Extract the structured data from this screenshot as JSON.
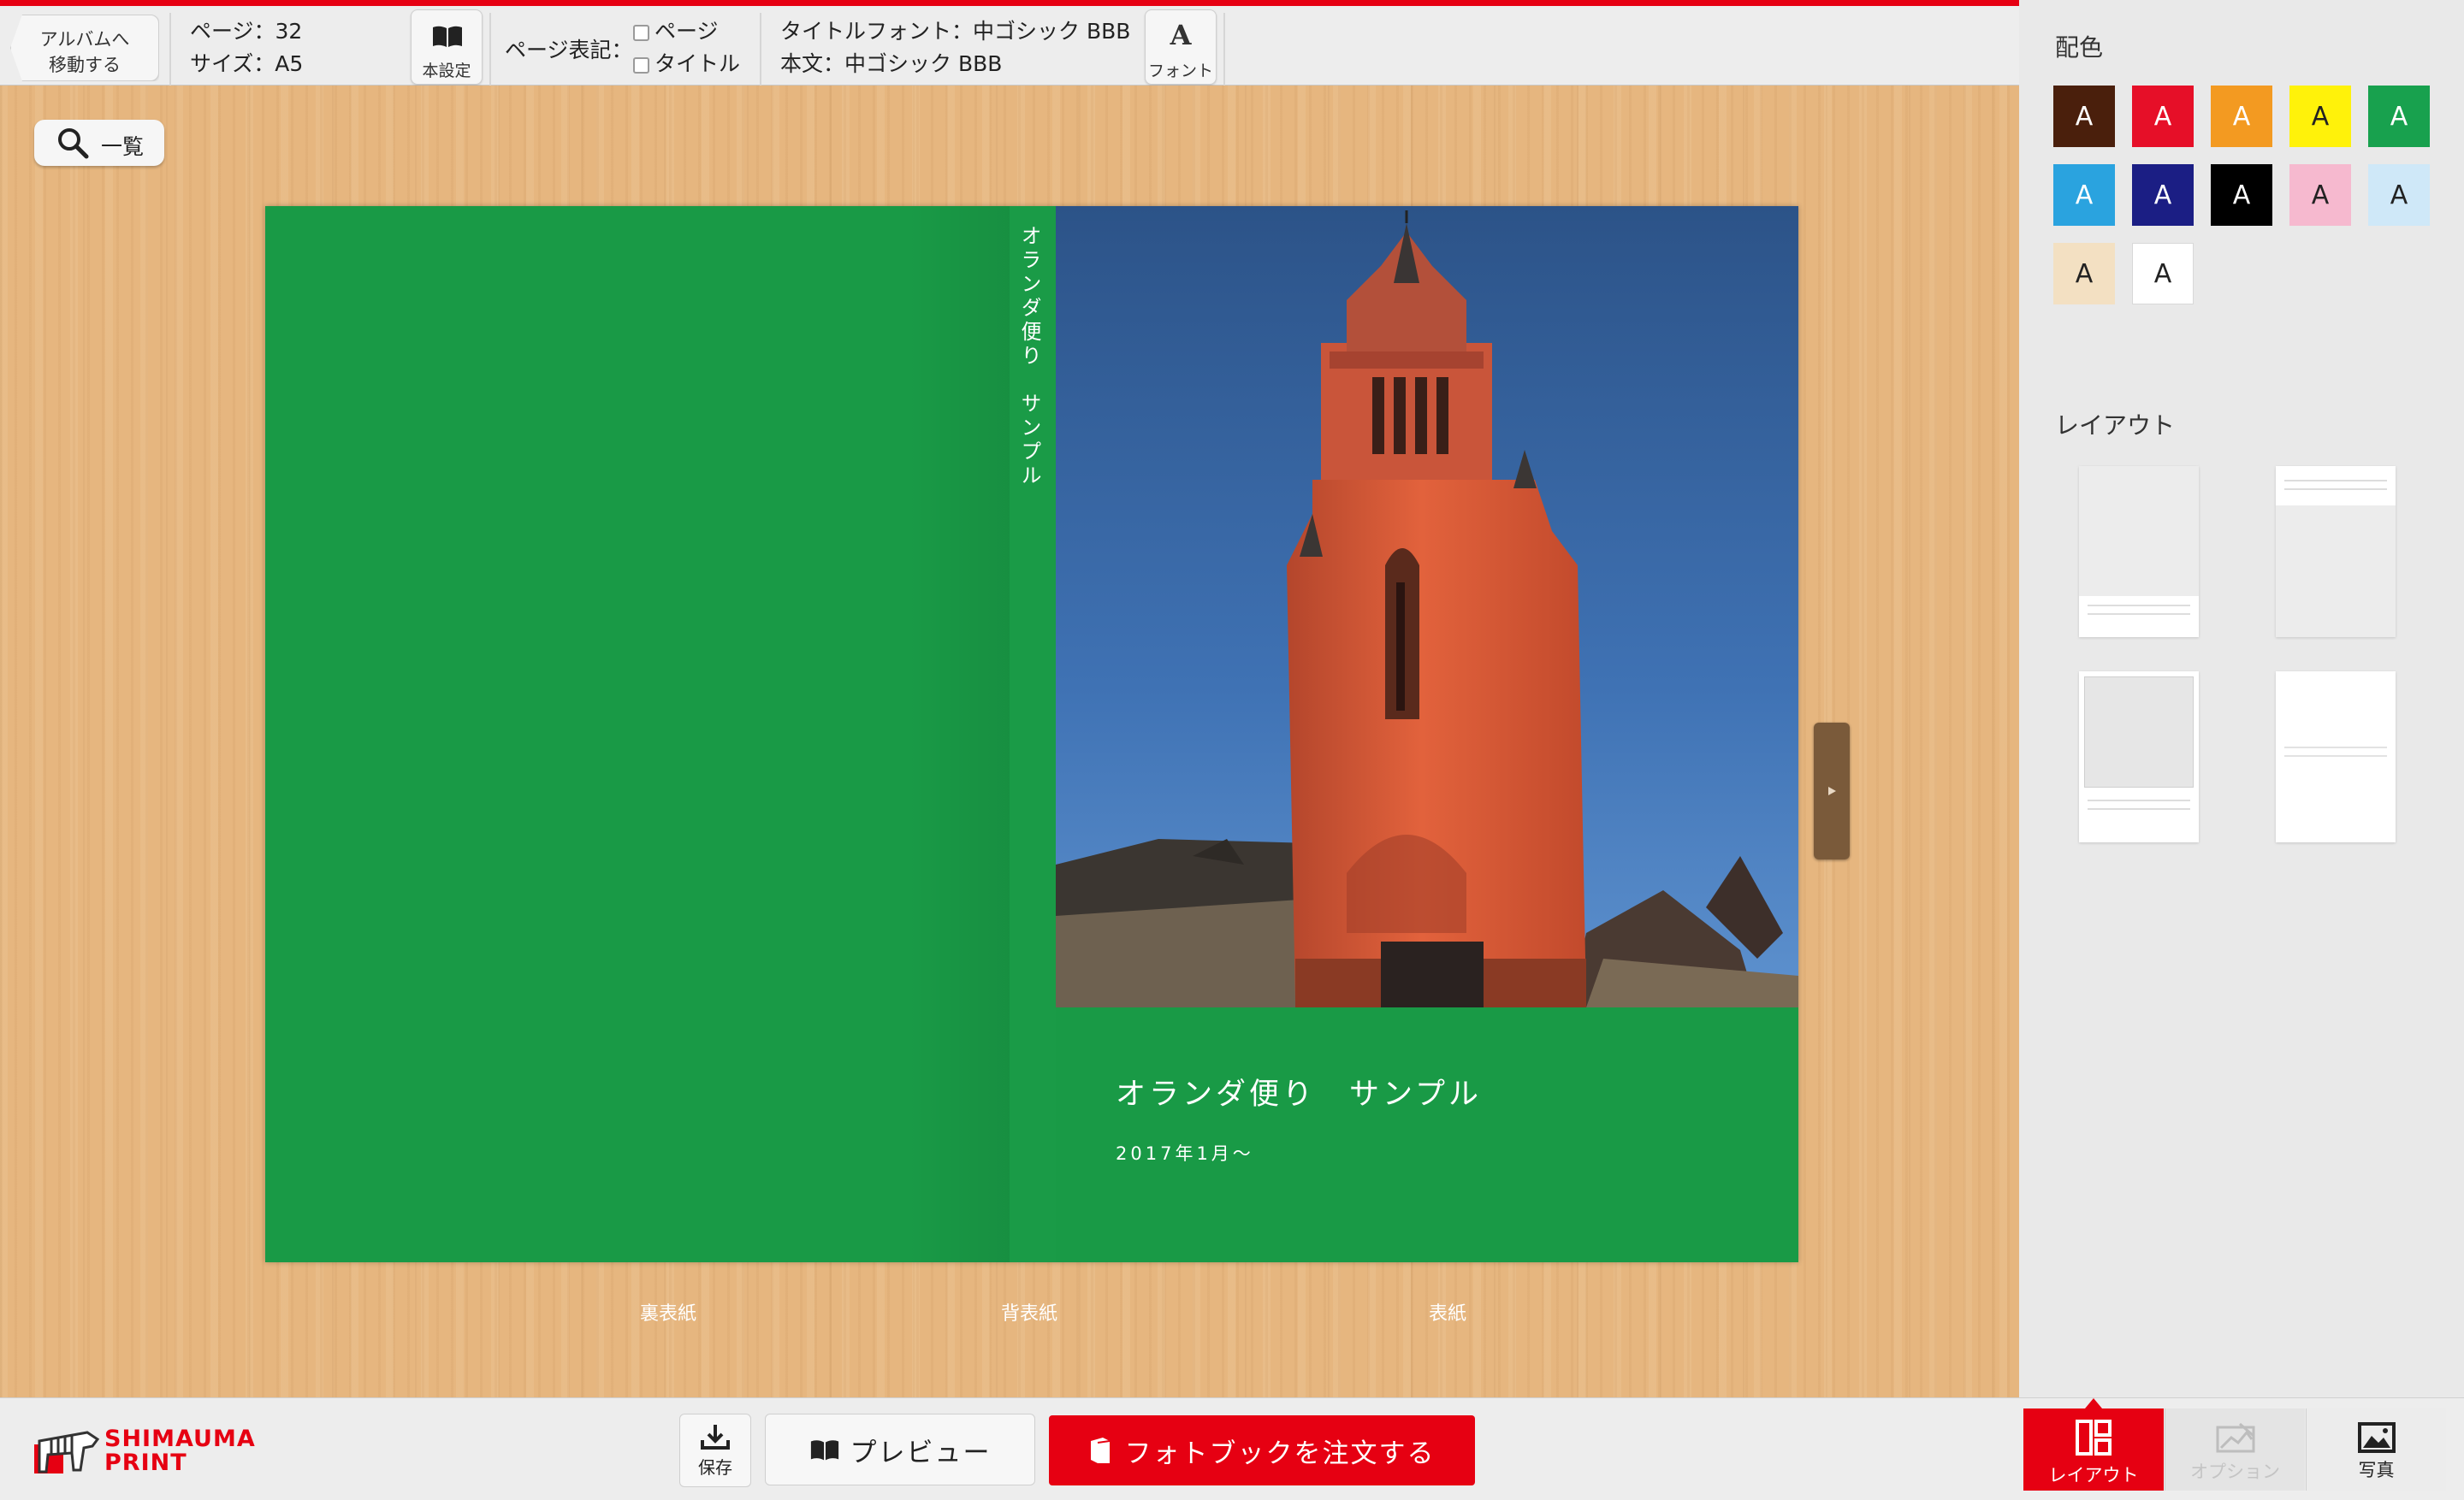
{
  "toolbar": {
    "back_label_line1": "アルバムへ",
    "back_label_line2": "移動する",
    "pages_label": "ページ：32",
    "size_label": "サイズ：A5",
    "book_settings_label": "本設定",
    "page_notation_label": "ページ表記：",
    "page_checkbox_label": "ページ",
    "title_checkbox_label": "タイトル",
    "title_font_label": "タイトルフォント：中ゴシック BBB",
    "body_font_label": "本文：中ゴシック BBB",
    "font_button_label": "フォント"
  },
  "workspace": {
    "list_button_label": "一覧",
    "spine_text": "オランダ便り　サンプル",
    "front_title": "オランダ便り　サンプル",
    "front_subtitle": "2017年1月〜",
    "labels": {
      "back_cover": "裏表紙",
      "spine": "背表紙",
      "front_cover": "表紙"
    }
  },
  "right_panel": {
    "color_heading": "配色",
    "layout_heading": "レイアウト",
    "swatches": [
      {
        "letter": "A",
        "bg": "#4a1f0c",
        "fg": "#ffffff"
      },
      {
        "letter": "A",
        "bg": "#e60f28",
        "fg": "#ffffff"
      },
      {
        "letter": "A",
        "bg": "#f39a21",
        "fg": "#ffffff"
      },
      {
        "letter": "A",
        "bg": "#fff20a",
        "fg": "#222222"
      },
      {
        "letter": "A",
        "bg": "#18a14e",
        "fg": "#ffffff"
      },
      {
        "letter": "A",
        "bg": "#2aa3df",
        "fg": "#ffffff"
      },
      {
        "letter": "A",
        "bg": "#1b1e84",
        "fg": "#ffffff"
      },
      {
        "letter": "A",
        "bg": "#000000",
        "fg": "#ffffff"
      },
      {
        "letter": "A",
        "bg": "#f6b9cf",
        "fg": "#222222"
      },
      {
        "letter": "A",
        "bg": "#cfe8f8",
        "fg": "#222222"
      },
      {
        "letter": "A",
        "bg": "#f3e0c2",
        "fg": "#222222"
      },
      {
        "letter": "A",
        "bg": "#ffffff",
        "fg": "#222222"
      }
    ]
  },
  "bottombar": {
    "logo_line1": "SHIMAUMA",
    "logo_line2": "PRINT",
    "save_label": "保存",
    "preview_label": "プレビュー",
    "order_label": "フォトブックを注文する",
    "tab_layout": "レイアウト",
    "tab_option": "オプション",
    "tab_photo": "写真"
  },
  "colors": {
    "accent": "#e60012",
    "cover_green": "#199a46",
    "wood": "#e6b67f"
  }
}
